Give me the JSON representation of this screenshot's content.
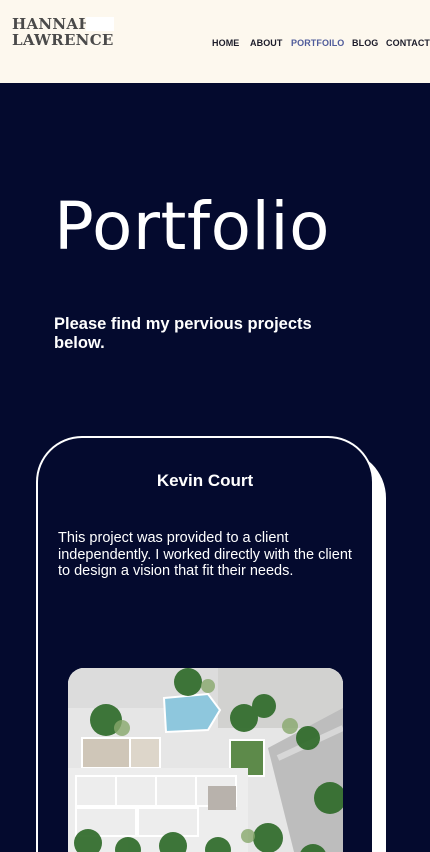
{
  "brand": {
    "line1": "HANNAH",
    "line2": "LAWRENCE"
  },
  "nav": {
    "home": "HOME",
    "about": "ABOUT",
    "portfolio": "PORTFOILO",
    "blog": "BLOG",
    "contact": "CONTACT",
    "active": "portfolio"
  },
  "page": {
    "title": "Portfolio",
    "intro": "Please find my pervious projects below."
  },
  "project": {
    "title": "Kevin Court",
    "description": "This project was provided to a client independently. I worked directly with the client to design a vision that fit their needs.",
    "image_label": "site-plan-rendering"
  },
  "colors": {
    "background": "#040a2e",
    "header_bg": "#fdf8ee",
    "nav_active": "#4f5b9a",
    "text_light": "#ffffff"
  }
}
